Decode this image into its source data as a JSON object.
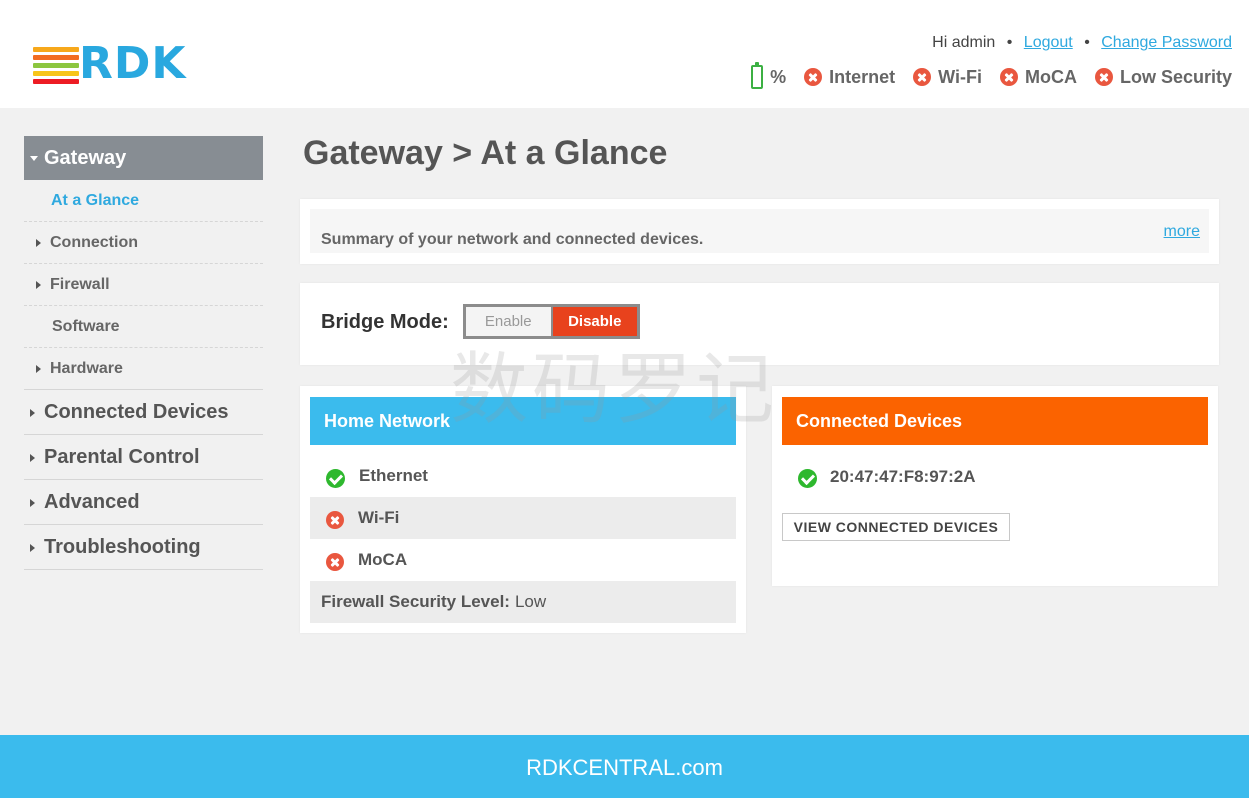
{
  "header": {
    "logo_text": "RDK",
    "greeting": "Hi admin",
    "logout_label": "Logout",
    "change_password_label": "Change Password",
    "status": {
      "battery_label": "%",
      "internet_label": "Internet",
      "wifi_label": "Wi-Fi",
      "moca_label": "MoCA",
      "security_label": "Low Security"
    },
    "logo_colors": [
      "#f7a81b",
      "#f26c21",
      "#8cc63f",
      "#f7c51b",
      "#ed1c24"
    ],
    "accent_color": "#29a8df"
  },
  "sidebar": {
    "active_section": "Gateway",
    "sub_items": [
      {
        "label": "At a Glance"
      },
      {
        "label": "Connection"
      },
      {
        "label": "Firewall"
      },
      {
        "label": "Software"
      },
      {
        "label": "Hardware"
      }
    ],
    "main_items": [
      {
        "label": "Connected Devices"
      },
      {
        "label": "Parental Control"
      },
      {
        "label": "Advanced"
      },
      {
        "label": "Troubleshooting"
      }
    ]
  },
  "main": {
    "page_title": "Gateway > At a Glance",
    "summary_text": "Summary of your network and connected devices.",
    "more_label": "more",
    "bridge_mode": {
      "label": "Bridge Mode:",
      "enable_label": "Enable",
      "disable_label": "Disable",
      "selected": "Disable"
    },
    "home_network": {
      "title": "Home Network",
      "rows": [
        {
          "label": "Ethernet",
          "status": "ok"
        },
        {
          "label": "Wi-Fi",
          "status": "error"
        },
        {
          "label": "MoCA",
          "status": "error"
        }
      ],
      "firewall_label": "Firewall Security Level:",
      "firewall_value": "Low"
    },
    "connected_devices": {
      "title": "Connected Devices",
      "devices": [
        "20:47:47:F8:97:2A"
      ],
      "view_button_label": "VIEW CONNECTED DEVICES"
    },
    "watermark": "数码罗记"
  },
  "footer": {
    "text": "RDKCENTRAL.com"
  }
}
